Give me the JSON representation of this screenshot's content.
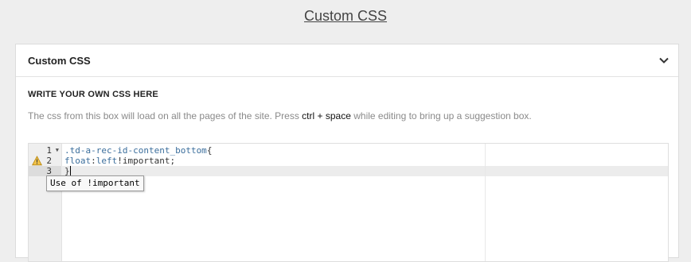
{
  "page": {
    "title": "Custom CSS"
  },
  "panel": {
    "title": "Custom CSS",
    "toggle_icon": "chevron-down-icon",
    "section_heading": "WRITE YOUR OWN CSS HERE",
    "help_text_before": "The css from this box will load on all the pages of the site. Press ",
    "help_key_1": "ctrl",
    "help_plus": " + ",
    "help_key_2": "space",
    "help_text_after": " while editing to bring up a suggestion box."
  },
  "editor": {
    "lines": [
      {
        "number": "1",
        "selector": ".td-a-rec-id-content_bottom",
        "brace": "{"
      },
      {
        "number": "2",
        "property": "float",
        "colon": ":",
        "value": "left",
        "rest": "!important;"
      },
      {
        "number": "3",
        "brace": "}"
      }
    ],
    "warning_icon": "warning-icon",
    "fold_icon": "fold-arrow-icon",
    "tooltip": "Use of !important"
  },
  "colors": {
    "background": "#eeeeee",
    "panel": "#ffffff",
    "token_blue": "#3b6e9c",
    "muted_text": "#8a8a8a"
  }
}
